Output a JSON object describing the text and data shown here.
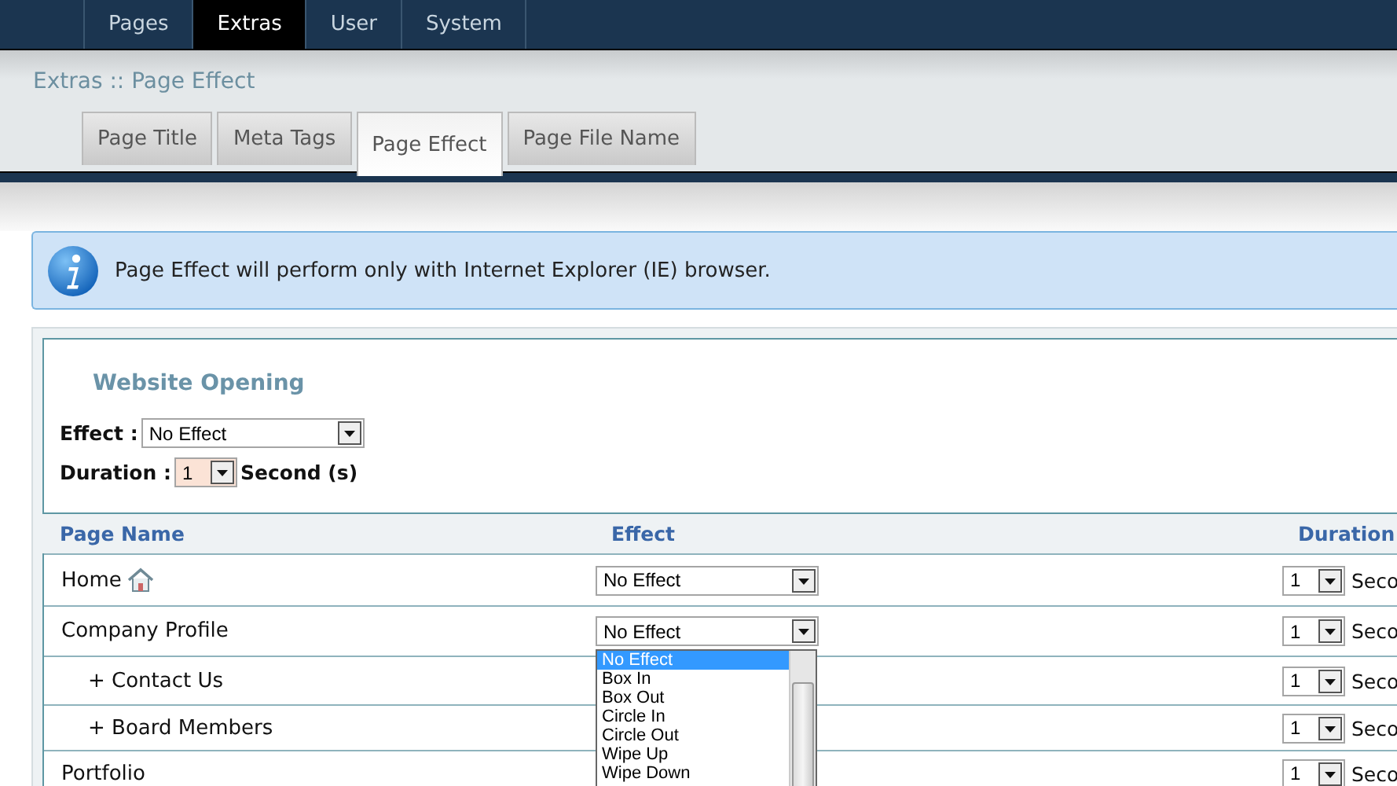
{
  "nav": [
    {
      "label": "Pages",
      "selected": false
    },
    {
      "label": "Extras",
      "selected": true
    },
    {
      "label": "User",
      "selected": false
    },
    {
      "label": "System",
      "selected": false
    }
  ],
  "breadcrumb": "Extras :: Page Effect",
  "tabs": [
    {
      "label": "Page Title",
      "selected": false
    },
    {
      "label": "Meta Tags",
      "selected": false
    },
    {
      "label": "Page Effect",
      "selected": true
    },
    {
      "label": "Page File Name",
      "selected": false
    }
  ],
  "info": "Page Effect will perform only with Internet Explorer (IE) browser.",
  "website_opening": {
    "title": "Website Opening",
    "effect_label": "Effect :",
    "effect_value": "No Effect",
    "duration_label": "Duration :",
    "duration_value": "1",
    "duration_unit": "Second (s)"
  },
  "table": {
    "columns": [
      "Page Name",
      "Effect",
      "Duration"
    ],
    "rows": [
      {
        "name": "Home",
        "home": true,
        "effect": "No Effect",
        "duration": "1",
        "unit": "Seco"
      },
      {
        "name": "Company Profile",
        "home": false,
        "effect": "No Effect",
        "duration": "1",
        "unit": "Seco",
        "dropdown_open": true,
        "children": [
          {
            "name": "+ Contact Us",
            "home": false,
            "duration": "1",
            "unit": "Seco"
          },
          {
            "name": "+ Board Members",
            "home": false,
            "duration": "1",
            "unit": "Seco"
          }
        ]
      },
      {
        "name": "Portfolio",
        "home": false,
        "duration": "1",
        "unit": "Seco"
      }
    ]
  },
  "dropdown": {
    "options": [
      {
        "label": "No Effect",
        "selected": true
      },
      {
        "label": "Box In",
        "selected": false
      },
      {
        "label": "Box Out",
        "selected": false
      },
      {
        "label": "Circle In",
        "selected": false
      },
      {
        "label": "Circle Out",
        "selected": false
      },
      {
        "label": "Wipe Up",
        "selected": false
      },
      {
        "label": "Wipe Down",
        "selected": false
      }
    ]
  }
}
